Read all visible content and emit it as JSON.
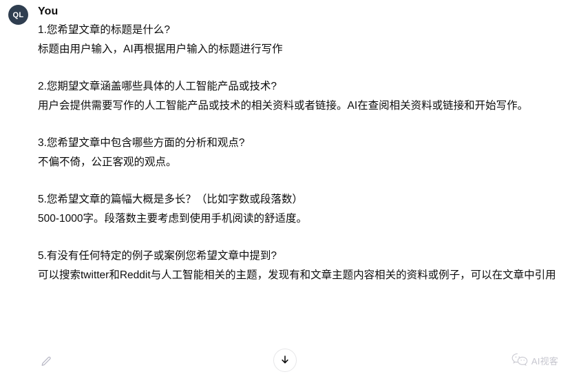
{
  "conversation": {
    "turn": {
      "avatar_initials": "QL",
      "author": "You",
      "blocks": [
        {
          "lines": [
            "1.您希望文章的标题是什么?",
            "标题由用户输入，AI再根据用户输入的标题进行写作"
          ]
        },
        {
          "lines": [
            "2.您期望文章涵盖哪些具体的人工智能产品或技术?",
            "用户会提供需要写作的人工智能产品或技术的相关资料或者链接。AI在查阅相关资料或链接和开始写作。"
          ]
        },
        {
          "lines": [
            "3.您希望文章中包含哪些方面的分析和观点?",
            "不偏不倚，公正客观的观点。"
          ]
        },
        {
          "lines": [
            "5.您希望文章的篇幅大概是多长？（比如字数或段落数）",
            "500-1000字。段落数主要考虑到使用手机阅读的舒适度。"
          ]
        },
        {
          "lines": [
            "5.有没有任何特定的例子或案例您希望文章中提到?",
            "可以搜索twitter和Reddit与人工智能相关的主题，发现有和文章主题内容相关的资料或例子，可以在文章中引用"
          ]
        }
      ]
    }
  },
  "bottom_bar": {
    "edit_icon": "pencil-icon",
    "scroll_down_icon": "arrow-down-icon",
    "watermark": {
      "icon": "wechat-icon",
      "text": "AI视客"
    }
  },
  "colors": {
    "avatar_bg": "#2f3e50",
    "text": "#0d0d0d",
    "background": "#ffffff",
    "muted": "#c4c4cd",
    "border": "#e6e6e8"
  }
}
